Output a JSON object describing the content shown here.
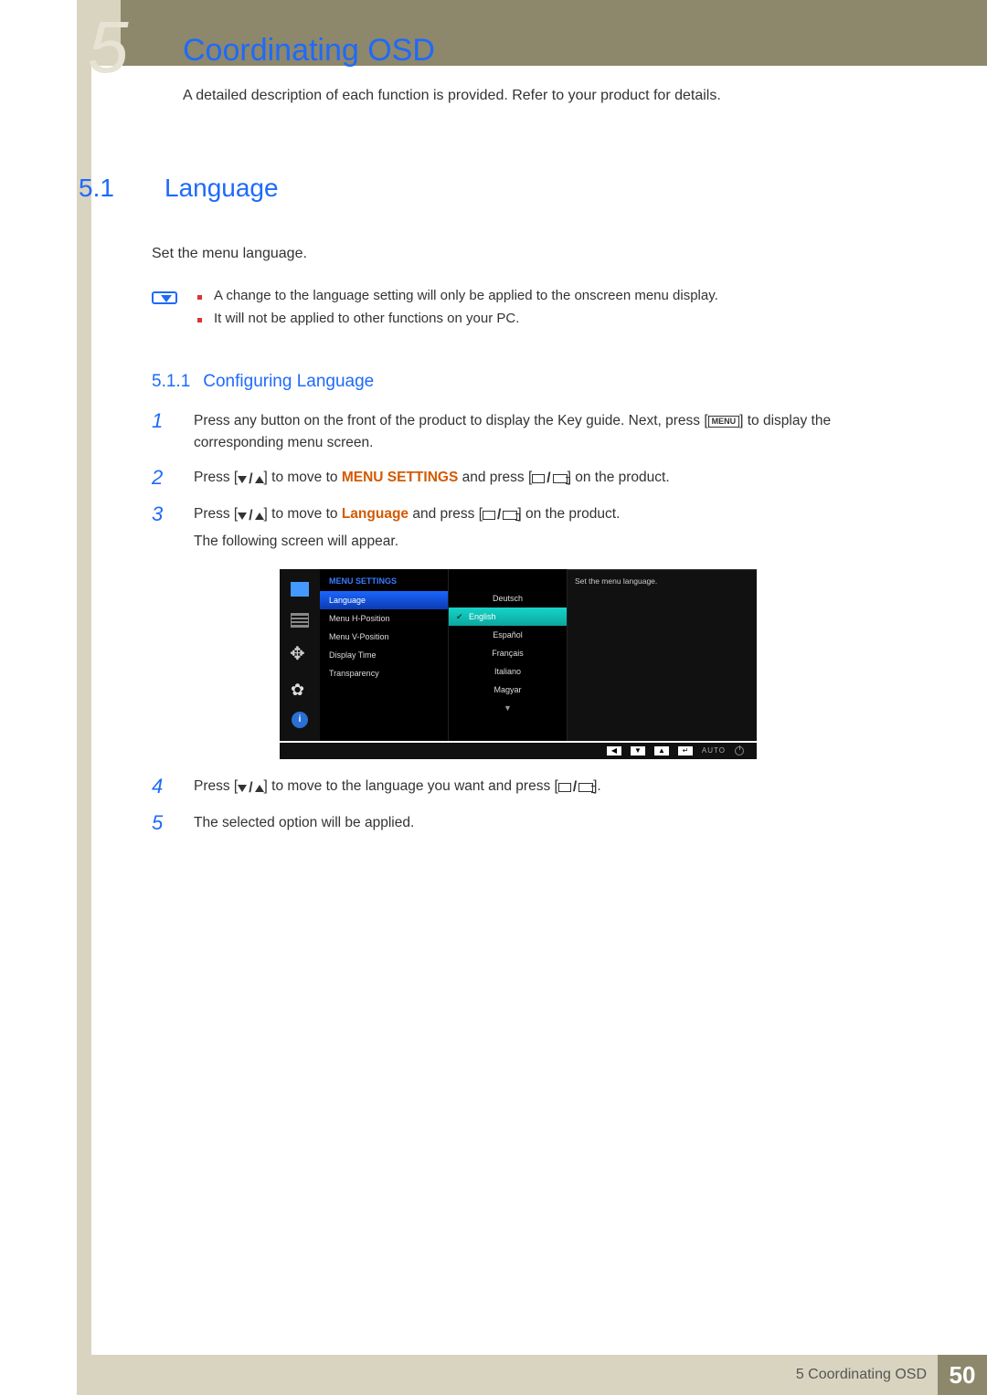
{
  "header": {
    "chapter_glyph": "5",
    "title": "Coordinating OSD",
    "subtitle": "A detailed description of each function is provided. Refer to your product for details."
  },
  "section": {
    "num": "5.1",
    "title": "Language",
    "intro": "Set the menu language.",
    "notes": [
      "A change to the language setting will only be applied to the onscreen menu display.",
      "It will not be applied to other functions on your PC."
    ],
    "sub": {
      "num": "5.1.1",
      "title": "Configuring Language"
    },
    "steps": {
      "s1_num": "1",
      "s1_a": "Press any button on the front of the product to display the Key guide. Next, press [",
      "s1_menu": "MENU",
      "s1_b": "] to display the corresponding menu screen.",
      "s2_num": "2",
      "s2_a": "Press [",
      "s2_b": "] to move to ",
      "s2_t": "MENU SETTINGS",
      "s2_c": " and press [",
      "s2_d": "] on the product.",
      "s3_num": "3",
      "s3_a": "Press [",
      "s3_b": "] to move to ",
      "s3_t": "Language",
      "s3_c": " and press [",
      "s3_d": "] on the product.",
      "s3_e": "The following screen will appear.",
      "s4_num": "4",
      "s4_a": "Press [",
      "s4_b": "] to move to the language you want and press [",
      "s4_c": "].",
      "s5_num": "5",
      "s5_a": "The selected option will be applied."
    }
  },
  "osd": {
    "menu_header": "MENU SETTINGS",
    "items": [
      "Language",
      "Menu H-Position",
      "Menu V-Position",
      "Display Time",
      "Transparency"
    ],
    "languages": [
      "Deutsch",
      "English",
      "Español",
      "Français",
      "Italiano",
      "Magyar"
    ],
    "selected_language_index": 1,
    "scroll_indicator": "▼",
    "description": "Set the menu language.",
    "footer_auto": "AUTO"
  },
  "footer": {
    "label": "5 Coordinating OSD",
    "page": "50"
  }
}
